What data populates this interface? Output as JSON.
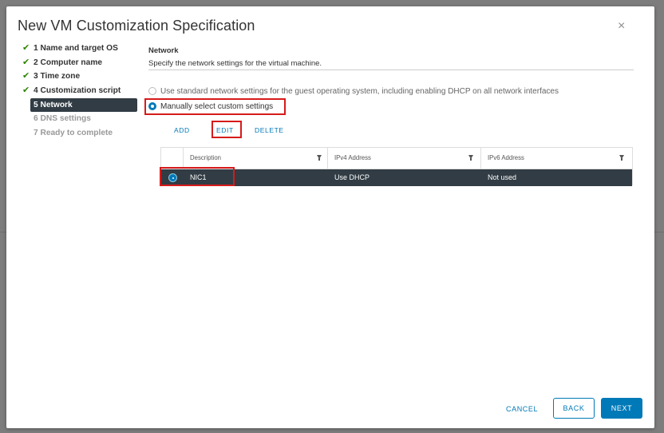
{
  "dialog": {
    "title": "New VM Customization Specification",
    "close_glyph": "×"
  },
  "steps": [
    {
      "label": "1 Name and target OS",
      "status": "done"
    },
    {
      "label": "2 Computer name",
      "status": "done"
    },
    {
      "label": "3 Time zone",
      "status": "done"
    },
    {
      "label": "4 Customization script",
      "status": "done"
    },
    {
      "label": "5 Network",
      "status": "active"
    },
    {
      "label": "6 DNS settings",
      "status": "disabled"
    },
    {
      "label": "7 Ready to complete",
      "status": "disabled"
    }
  ],
  "check_glyph": "✔",
  "network": {
    "title": "Network",
    "description": "Specify the network settings for the virtual machine.",
    "option_standard": "Use standard network settings for the guest operating system, including enabling DHCP on all network interfaces",
    "option_custom": "Manually select custom settings",
    "selected_option": "custom"
  },
  "grid_actions": {
    "add": "ADD",
    "edit": "EDIT",
    "delete": "DELETE"
  },
  "grid": {
    "columns": [
      "Description",
      "IPv4 Address",
      "IPv6 Address"
    ],
    "rows": [
      {
        "description": "NIC1",
        "ipv4": "Use DHCP",
        "ipv6": "Not used",
        "selected": true
      }
    ]
  },
  "footer": {
    "cancel": "CANCEL",
    "back": "BACK",
    "next": "NEXT"
  },
  "colors": {
    "accent": "#0079b8",
    "active_step_bg": "#313c44",
    "check_green": "#2f8400",
    "highlight_red": "#d61b1b"
  }
}
